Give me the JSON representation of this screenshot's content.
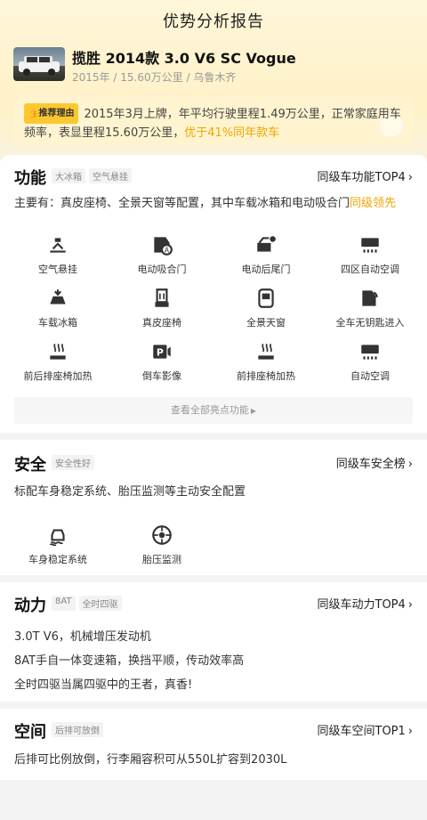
{
  "header": {
    "title": "优势分析报告"
  },
  "car": {
    "title": "揽胜 2014款 3.0 V6 SC Vogue",
    "year": "2015年",
    "mileage": "15.60万公里",
    "city": "乌鲁木齐",
    "sep": "/"
  },
  "reason": {
    "tag": "推荐理由",
    "text": "2015年3月上牌，年平均行驶里程1.49万公里，正常家庭用车频率，表显里程15.60万公里，",
    "highlight": "优于41%同年款车"
  },
  "function": {
    "title": "功能",
    "tags": [
      "大冰箱",
      "空气悬挂"
    ],
    "rank": "同级车功能TOP4",
    "desc": "主要有：真皮座椅、全景天窗等配置，其中车载冰箱和电动吸合门",
    "lead": "同级领先",
    "features": [
      {
        "label": "空气悬挂",
        "icon": "air-suspension-icon"
      },
      {
        "label": "电动吸合门",
        "icon": "soft-close-door-icon"
      },
      {
        "label": "电动后尾门",
        "icon": "power-tailgate-icon"
      },
      {
        "label": "四区自动空调",
        "icon": "four-zone-ac-icon"
      },
      {
        "label": "车载冰箱",
        "icon": "car-fridge-icon"
      },
      {
        "label": "真皮座椅",
        "icon": "leather-seat-icon"
      },
      {
        "label": "全景天窗",
        "icon": "panoramic-sunroof-icon"
      },
      {
        "label": "全车无钥匙进入",
        "icon": "keyless-entry-icon"
      },
      {
        "label": "前后排座椅加热",
        "icon": "seat-heating-icon"
      },
      {
        "label": "倒车影像",
        "icon": "parking-camera-icon"
      },
      {
        "label": "前排座椅加热",
        "icon": "front-seat-heating-icon"
      },
      {
        "label": "自动空调",
        "icon": "auto-ac-icon"
      }
    ],
    "more": "查看全部亮点功能"
  },
  "safety": {
    "title": "安全",
    "tags": [
      "安全性好"
    ],
    "rank": "同级车安全榜",
    "desc": "标配车身稳定系统、胎压监测等主动安全配置",
    "features": [
      {
        "label": "车身稳定系统",
        "icon": "stability-control-icon"
      },
      {
        "label": "胎压监测",
        "icon": "tire-pressure-icon"
      }
    ]
  },
  "power": {
    "title": "动力",
    "tags": [
      "8AT",
      "全时四驱"
    ],
    "rank": "同级车动力TOP4",
    "lines": [
      "3.0T V6，机械增压发动机",
      "8AT手自一体变速箱，换挡平顺，传动效率高",
      "全时四驱当属四驱中的王者，真香!"
    ]
  },
  "space": {
    "title": "空间",
    "tags": [
      "后排可放倒"
    ],
    "rank": "同级车空间TOP1",
    "desc": "后排可比例放倒，行李厢容积可从550L扩容到2030L"
  },
  "colors": {
    "accent": "#f0a500",
    "tag_yellow": "#fdc82f",
    "hero_bg": "#fff6d9"
  }
}
